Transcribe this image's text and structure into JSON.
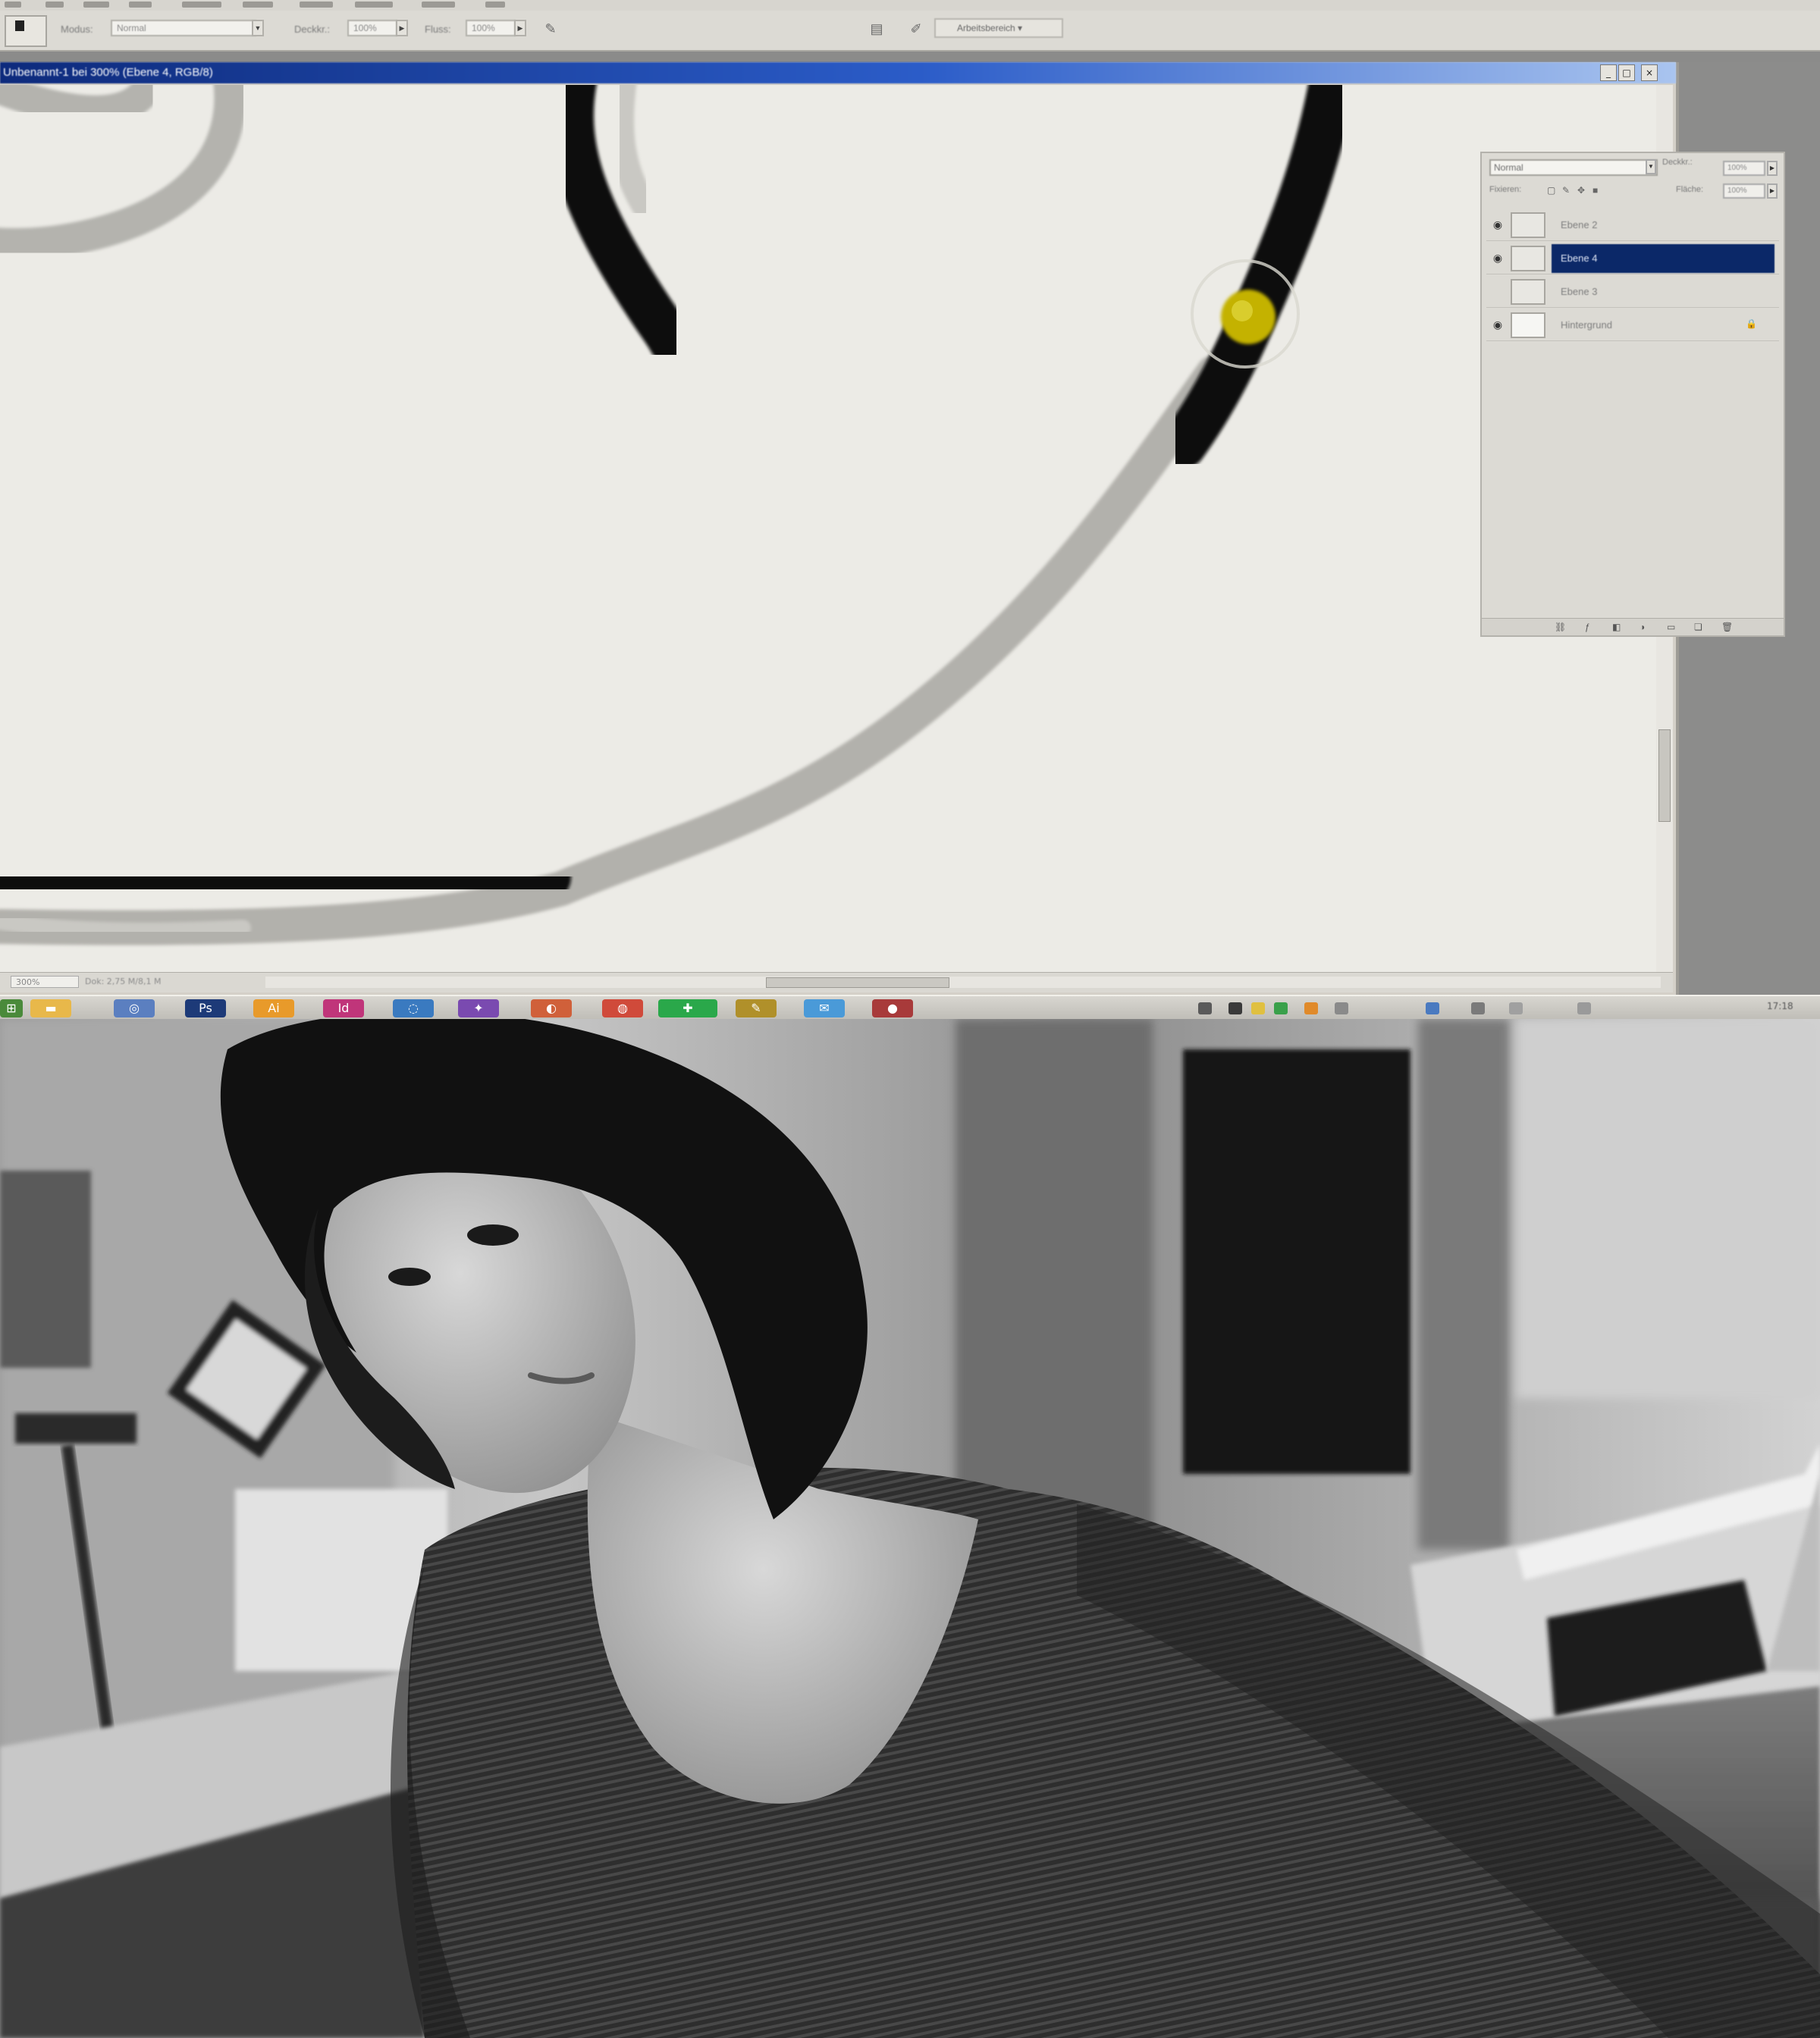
{
  "app": {
    "name": "Adobe Photoshop",
    "accent_color": "#0b2868",
    "title_bar_color": "#1c45a8"
  },
  "options_bar": {
    "tool_icon": "brush-tool-icon",
    "mode_label": "Modus:",
    "mode_value": "Normal",
    "opacity_label": "Deckkr.:",
    "opacity_value": "100%",
    "flow_label": "Fluss:",
    "flow_value": "100%",
    "airbrush_icon": "airbrush-icon",
    "palette_well_icon": "palette-well-icon",
    "brush_preset_icon": "brush-preset-icon",
    "workspace_label": "Arbeitsbereich ▾"
  },
  "document": {
    "title": "Unbenannt-1 bei 300% (Ebene 4, RGB/8)",
    "zoom": "300%",
    "status_info": "Dok: 2,75 M/8,1 M",
    "window_buttons": [
      "_",
      "□",
      "×"
    ]
  },
  "layers_panel": {
    "blend_mode": "Normal",
    "opacity_label": "Deckkr.:",
    "opacity_value": "100%",
    "lock_label": "Fixieren:",
    "fill_label": "Fläche:",
    "fill_value": "100%",
    "layers": [
      {
        "name": "Ebene 2",
        "visible": true,
        "selected": false
      },
      {
        "name": "Ebene 4",
        "visible": true,
        "selected": true
      },
      {
        "name": "Ebene 3",
        "visible": false,
        "selected": false
      },
      {
        "name": "Hintergrund",
        "visible": true,
        "selected": false,
        "locked": true
      }
    ],
    "footer_icons": [
      "link-icon",
      "layer-style-icon",
      "mask-icon",
      "adjustment-icon",
      "group-icon",
      "new-layer-icon",
      "trash-icon"
    ]
  },
  "taskbar": {
    "clock": "17:18",
    "apps": [
      {
        "icon": "start-icon",
        "color": "#4a8a3a"
      },
      {
        "icon": "folder-icon",
        "color": "#e8b84a"
      },
      {
        "icon": "explorer-icon",
        "color": "#5b7fc0"
      },
      {
        "icon": "photoshop-icon",
        "color": "#1d3a78"
      },
      {
        "icon": "illustrator-icon",
        "color": "#e89a2a"
      },
      {
        "icon": "indesign-icon",
        "color": "#c0357a"
      },
      {
        "icon": "browser-icon",
        "color": "#3a7ac0"
      },
      {
        "icon": "messenger-icon",
        "color": "#7a4ab0"
      },
      {
        "icon": "firefox-icon",
        "color": "#d0603a"
      },
      {
        "icon": "chrome-icon",
        "color": "#d04a3a"
      },
      {
        "icon": "game-icon",
        "color": "#2aa84a"
      },
      {
        "icon": "pencil-icon",
        "color": "#b0902a"
      },
      {
        "icon": "twitter-icon",
        "color": "#4a9ad8"
      },
      {
        "icon": "recorder-icon",
        "color": "#a83a3a"
      }
    ]
  },
  "photo": {
    "subject": "woman-at-desk-photo",
    "tone": "black-and-white"
  }
}
